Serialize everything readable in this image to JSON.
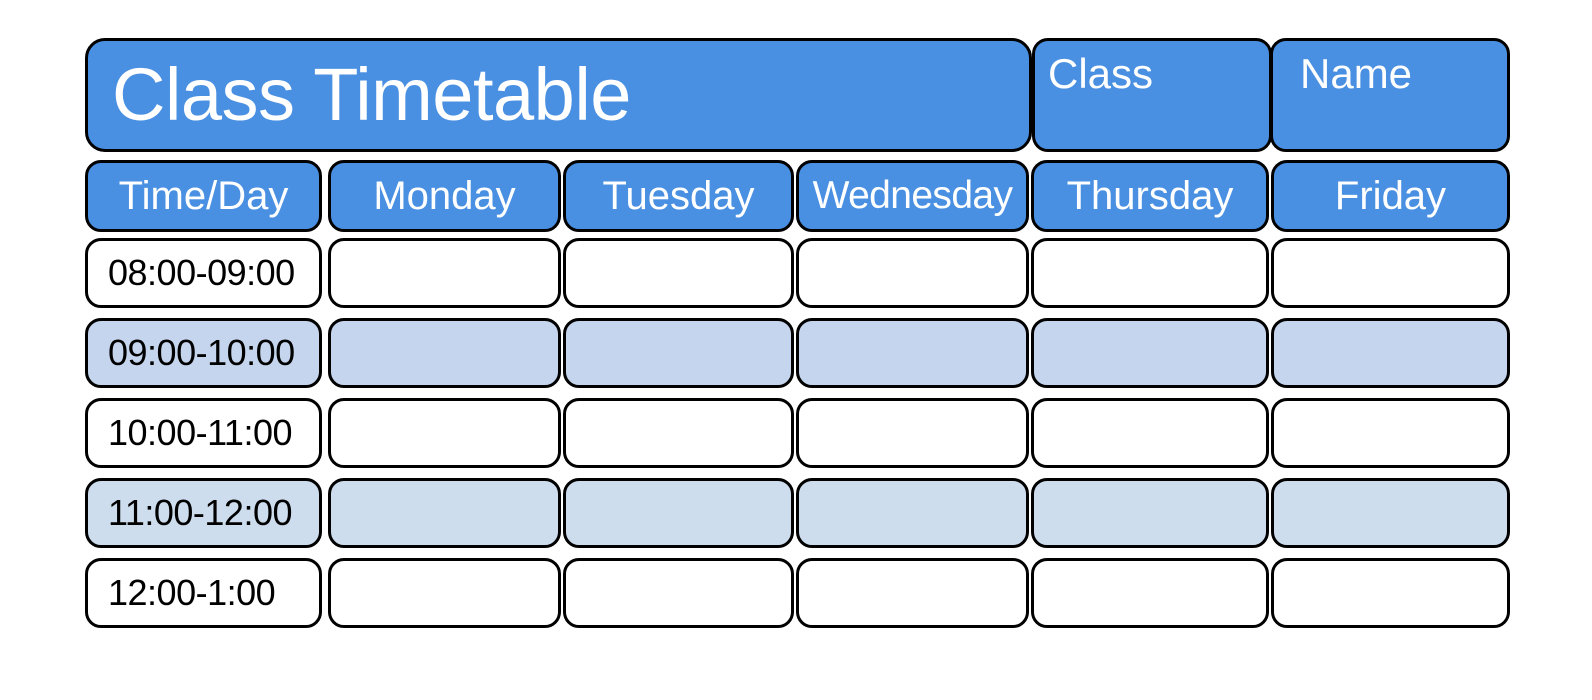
{
  "header": {
    "title": "Class Timetable",
    "class_label": "Class",
    "name_label": "Name"
  },
  "colors": {
    "header_blue": "#4a90e2",
    "row_shade_a": "#c5d5ed",
    "row_shade_b": "#cddded",
    "border": "#000000",
    "header_text": "#ffffff",
    "body_text": "#000000",
    "cell_background": "#ffffff"
  },
  "columns": [
    {
      "label": "Time/Day"
    },
    {
      "label": "Monday"
    },
    {
      "label": "Tuesday"
    },
    {
      "label": "Wednesday"
    },
    {
      "label": "Thursday"
    },
    {
      "label": "Friday"
    }
  ],
  "rows": [
    {
      "time": "08:00-09:00",
      "shade": "white",
      "cells": [
        "",
        "",
        "",
        "",
        ""
      ]
    },
    {
      "time": "09:00-10:00",
      "shade": "shade-a",
      "cells": [
        "",
        "",
        "",
        "",
        ""
      ]
    },
    {
      "time": "10:00-11:00",
      "shade": "white",
      "cells": [
        "",
        "",
        "",
        "",
        ""
      ]
    },
    {
      "time": "11:00-12:00",
      "shade": "shade-b",
      "cells": [
        "",
        "",
        "",
        "",
        ""
      ]
    },
    {
      "time": "12:00-1:00",
      "shade": "white",
      "cells": [
        "",
        "",
        "",
        "",
        ""
      ]
    }
  ]
}
